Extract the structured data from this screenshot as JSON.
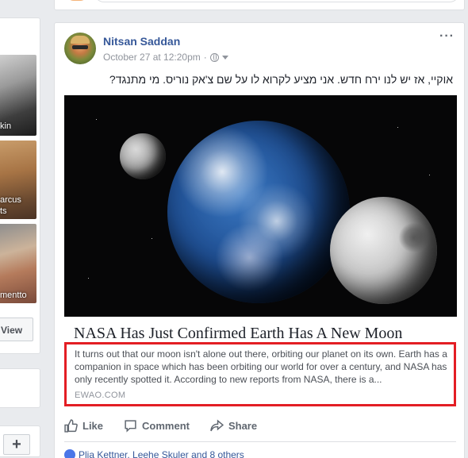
{
  "left_column": {
    "friends": [
      {
        "name_fragment": "kin"
      },
      {
        "name_fragment_1": "arcus",
        "name_fragment_2": "ts"
      },
      {
        "name_fragment": "mentto"
      }
    ],
    "view_button_label": "View",
    "add_button_label": "+"
  },
  "post": {
    "author": "Nitsan Saddan",
    "timestamp": "October 27 at 12:20pm",
    "separator": "·",
    "more_label": "···",
    "text": "אוקיי, אז יש לנו ירח חדש. אני מציע לקרוא לו על שם צ'אק נוריס. מי מתנגד?",
    "link": {
      "title": "NASA Has Just Confirmed Earth Has A New Moon",
      "description": "It turns out that our moon isn't alone out there, orbiting our planet on its own. Earth has a companion in space which has been orbiting our world for over a century, and NASA has only recently spotted it. According to new reports from NASA, there is a...",
      "domain": "EWAO.COM"
    },
    "actions": {
      "like": "Like",
      "comment": "Comment",
      "share": "Share"
    },
    "reactions_text": "Plia Kettner, Leehe Skuler and 8 others"
  },
  "colors": {
    "highlight_border": "#e31e24",
    "link_blue": "#365899",
    "background": "#e9ebee"
  }
}
